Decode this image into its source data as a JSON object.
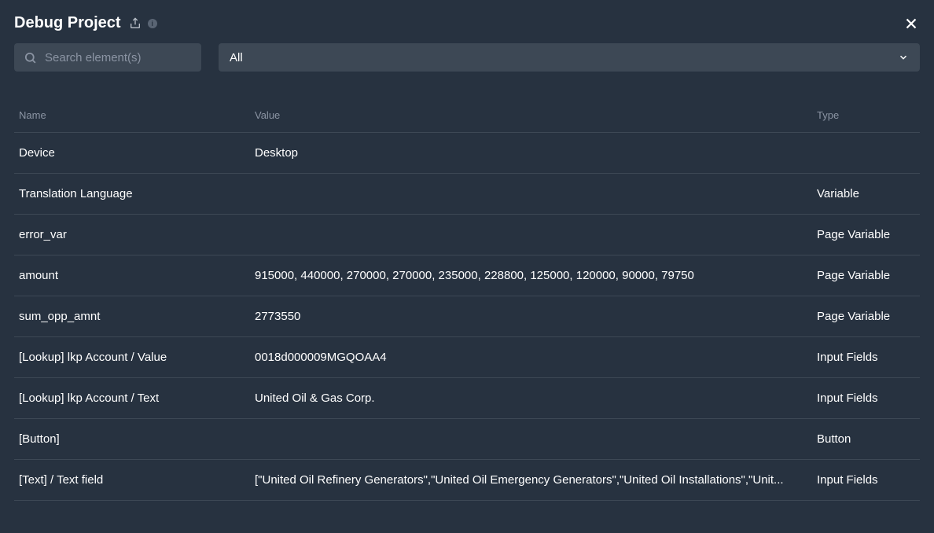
{
  "header": {
    "title": "Debug Project",
    "info": "i"
  },
  "search": {
    "placeholder": "Search element(s)"
  },
  "filter": {
    "selected": "All"
  },
  "columns": {
    "name": "Name",
    "value": "Value",
    "type": "Type"
  },
  "rows": [
    {
      "name": "Device",
      "value": "Desktop",
      "type": ""
    },
    {
      "name": "Translation Language",
      "value": "",
      "type": "Variable"
    },
    {
      "name": "error_var",
      "value": "",
      "type": "Page Variable"
    },
    {
      "name": "amount",
      "value": "915000, 440000, 270000, 270000, 235000, 228800, 125000, 120000, 90000, 79750",
      "type": "Page Variable"
    },
    {
      "name": "sum_opp_amnt",
      "value": "2773550",
      "type": "Page Variable"
    },
    {
      "name": "[Lookup] lkp Account / Value",
      "value": "0018d000009MGQOAA4",
      "type": "Input Fields"
    },
    {
      "name": "[Lookup] lkp Account / Text",
      "value": "United Oil & Gas Corp.",
      "type": "Input Fields"
    },
    {
      "name": "[Button]",
      "value": "",
      "type": "Button"
    },
    {
      "name": "[Text]  / Text field",
      "value": "[\"United Oil Refinery Generators\",\"United Oil Emergency Generators\",\"United Oil Installations\",\"Unit...",
      "type": "Input Fields"
    }
  ]
}
